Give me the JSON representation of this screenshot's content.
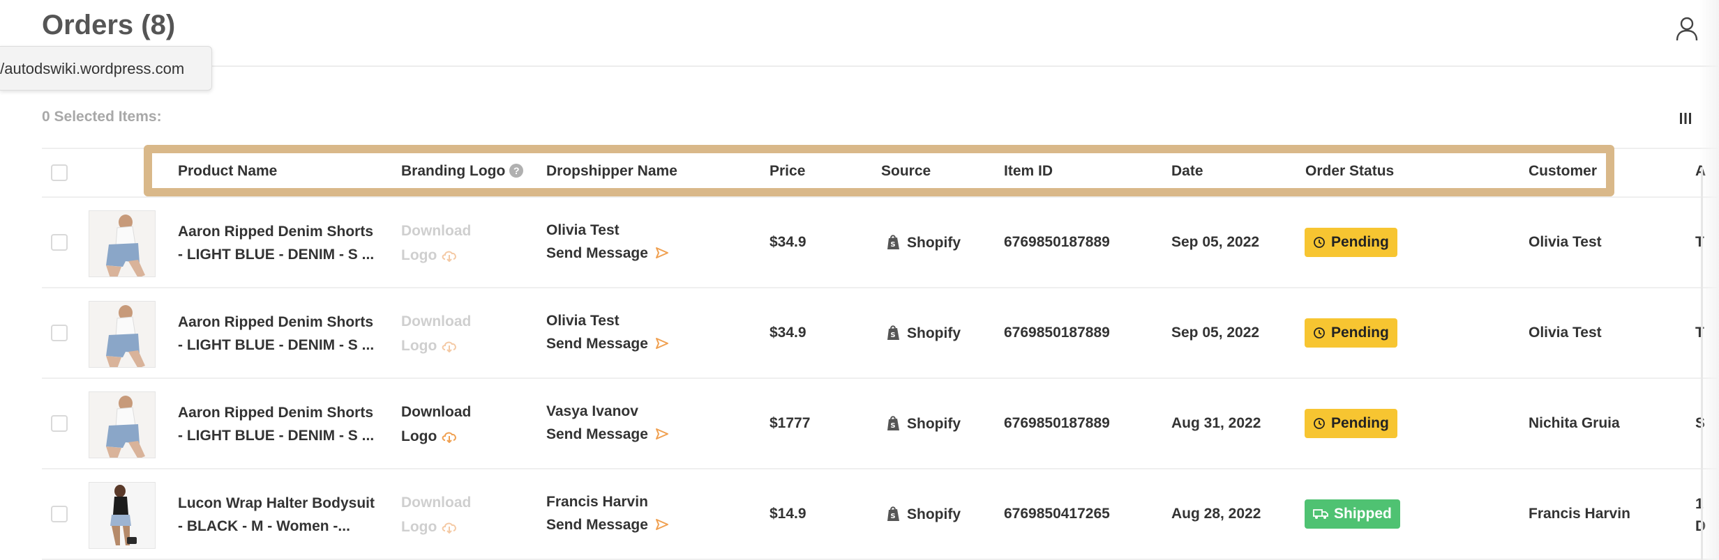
{
  "header": {
    "title": "Orders (8)"
  },
  "tooltip": {
    "url": "//autodswiki.wordpress.com"
  },
  "toolbar": {
    "selected_text": "0 Selected Items:"
  },
  "columns": {
    "product_name": "Product Name",
    "branding_logo": "Branding Logo",
    "dropshipper_name": "Dropshipper Name",
    "price": "Price",
    "source": "Source",
    "item_id": "Item ID",
    "date": "Date",
    "order_status": "Order Status",
    "customer": "Customer",
    "next_col_partial": "A"
  },
  "colors": {
    "highlight": "#d9b889",
    "pending": "#f7c531",
    "shipped": "#4fc272",
    "send_icon": "#f0a050"
  },
  "rows": [
    {
      "product_line1": "Aaron Ripped Denim Shorts",
      "product_line2": "- LIGHT BLUE - DENIM - S ...",
      "logo_line1": "Download",
      "logo_line2": "Logo",
      "logo_enabled": false,
      "dropshipper": "Olivia Test",
      "send_message": "Send Message",
      "price": "$34.9",
      "source": "Shopify",
      "item_id": "6769850187889",
      "date": "Sep 05, 2022",
      "status": "Pending",
      "customer": "Olivia Test",
      "edge1": "T",
      "edge2": ""
    },
    {
      "product_line1": "Aaron Ripped Denim Shorts",
      "product_line2": "- LIGHT BLUE - DENIM - S ...",
      "logo_line1": "Download",
      "logo_line2": "Logo",
      "logo_enabled": false,
      "dropshipper": "Olivia Test",
      "send_message": "Send Message",
      "price": "$34.9",
      "source": "Shopify",
      "item_id": "6769850187889",
      "date": "Sep 05, 2022",
      "status": "Pending",
      "customer": "Olivia Test",
      "edge1": "T",
      "edge2": ""
    },
    {
      "product_line1": "Aaron Ripped Denim Shorts",
      "product_line2": "- LIGHT BLUE - DENIM - S ...",
      "logo_line1": "Download",
      "logo_line2": "Logo",
      "logo_enabled": true,
      "dropshipper": "Vasya Ivanov",
      "send_message": "Send Message",
      "price": "$1777",
      "source": "Shopify",
      "item_id": "6769850187889",
      "date": "Aug 31, 2022",
      "status": "Pending",
      "customer": "Nichita Gruia",
      "edge1": "S",
      "edge2": ""
    },
    {
      "product_line1": "Lucon Wrap Halter Bodysuit",
      "product_line2": "- BLACK - M - Women -...",
      "logo_line1": "Download",
      "logo_line2": "Logo",
      "logo_enabled": false,
      "dropshipper": "Francis Harvin",
      "send_message": "Send Message",
      "price": "$14.9",
      "source": "Shopify",
      "item_id": "6769850417265",
      "date": "Aug 28, 2022",
      "status": "Shipped",
      "customer": "Francis Harvin",
      "edge1": "1",
      "edge2": "D"
    }
  ]
}
